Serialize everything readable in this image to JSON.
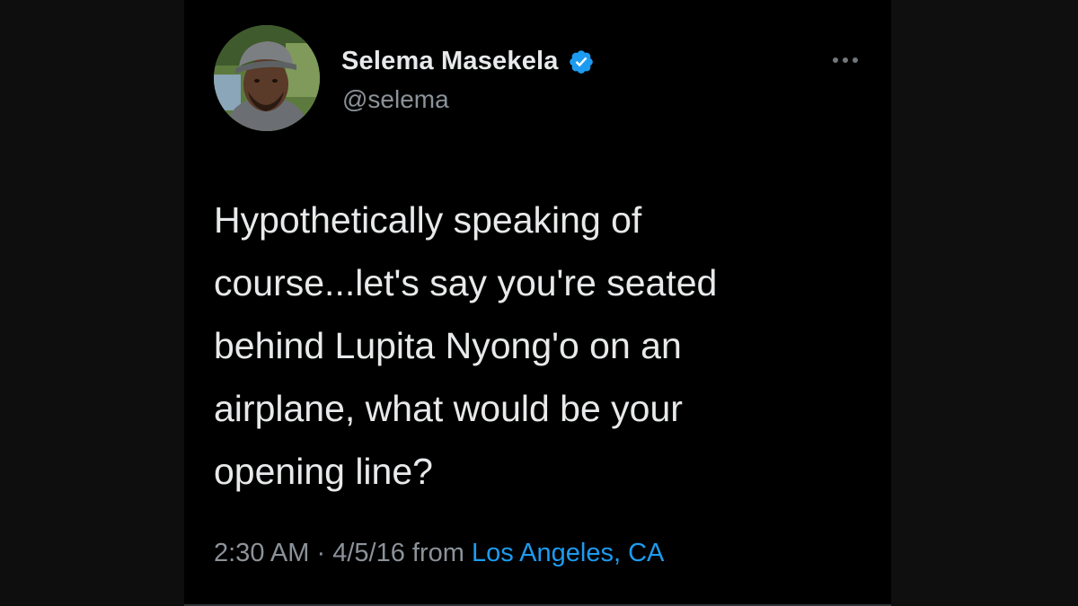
{
  "tweet": {
    "author": {
      "display_name": "Selema Masekela",
      "handle": "@selema",
      "verified": true,
      "avatar_icon": "user-avatar-photo"
    },
    "more_icon": "more-horizontal-icon",
    "text": "Hypothetically speaking of\ncourse...let's say you're seated\nbehind Lupita Nyong'o on an\nairplane, what would be your\nopening line?",
    "time": "2:30 AM",
    "separator": "·",
    "date": "4/5/16",
    "from_label": "from",
    "location": "Los Angeles, CA"
  },
  "colors": {
    "background": "#000000",
    "text_primary": "#e7e9ea",
    "text_secondary": "#8b9299",
    "accent": "#1d9bf0"
  }
}
